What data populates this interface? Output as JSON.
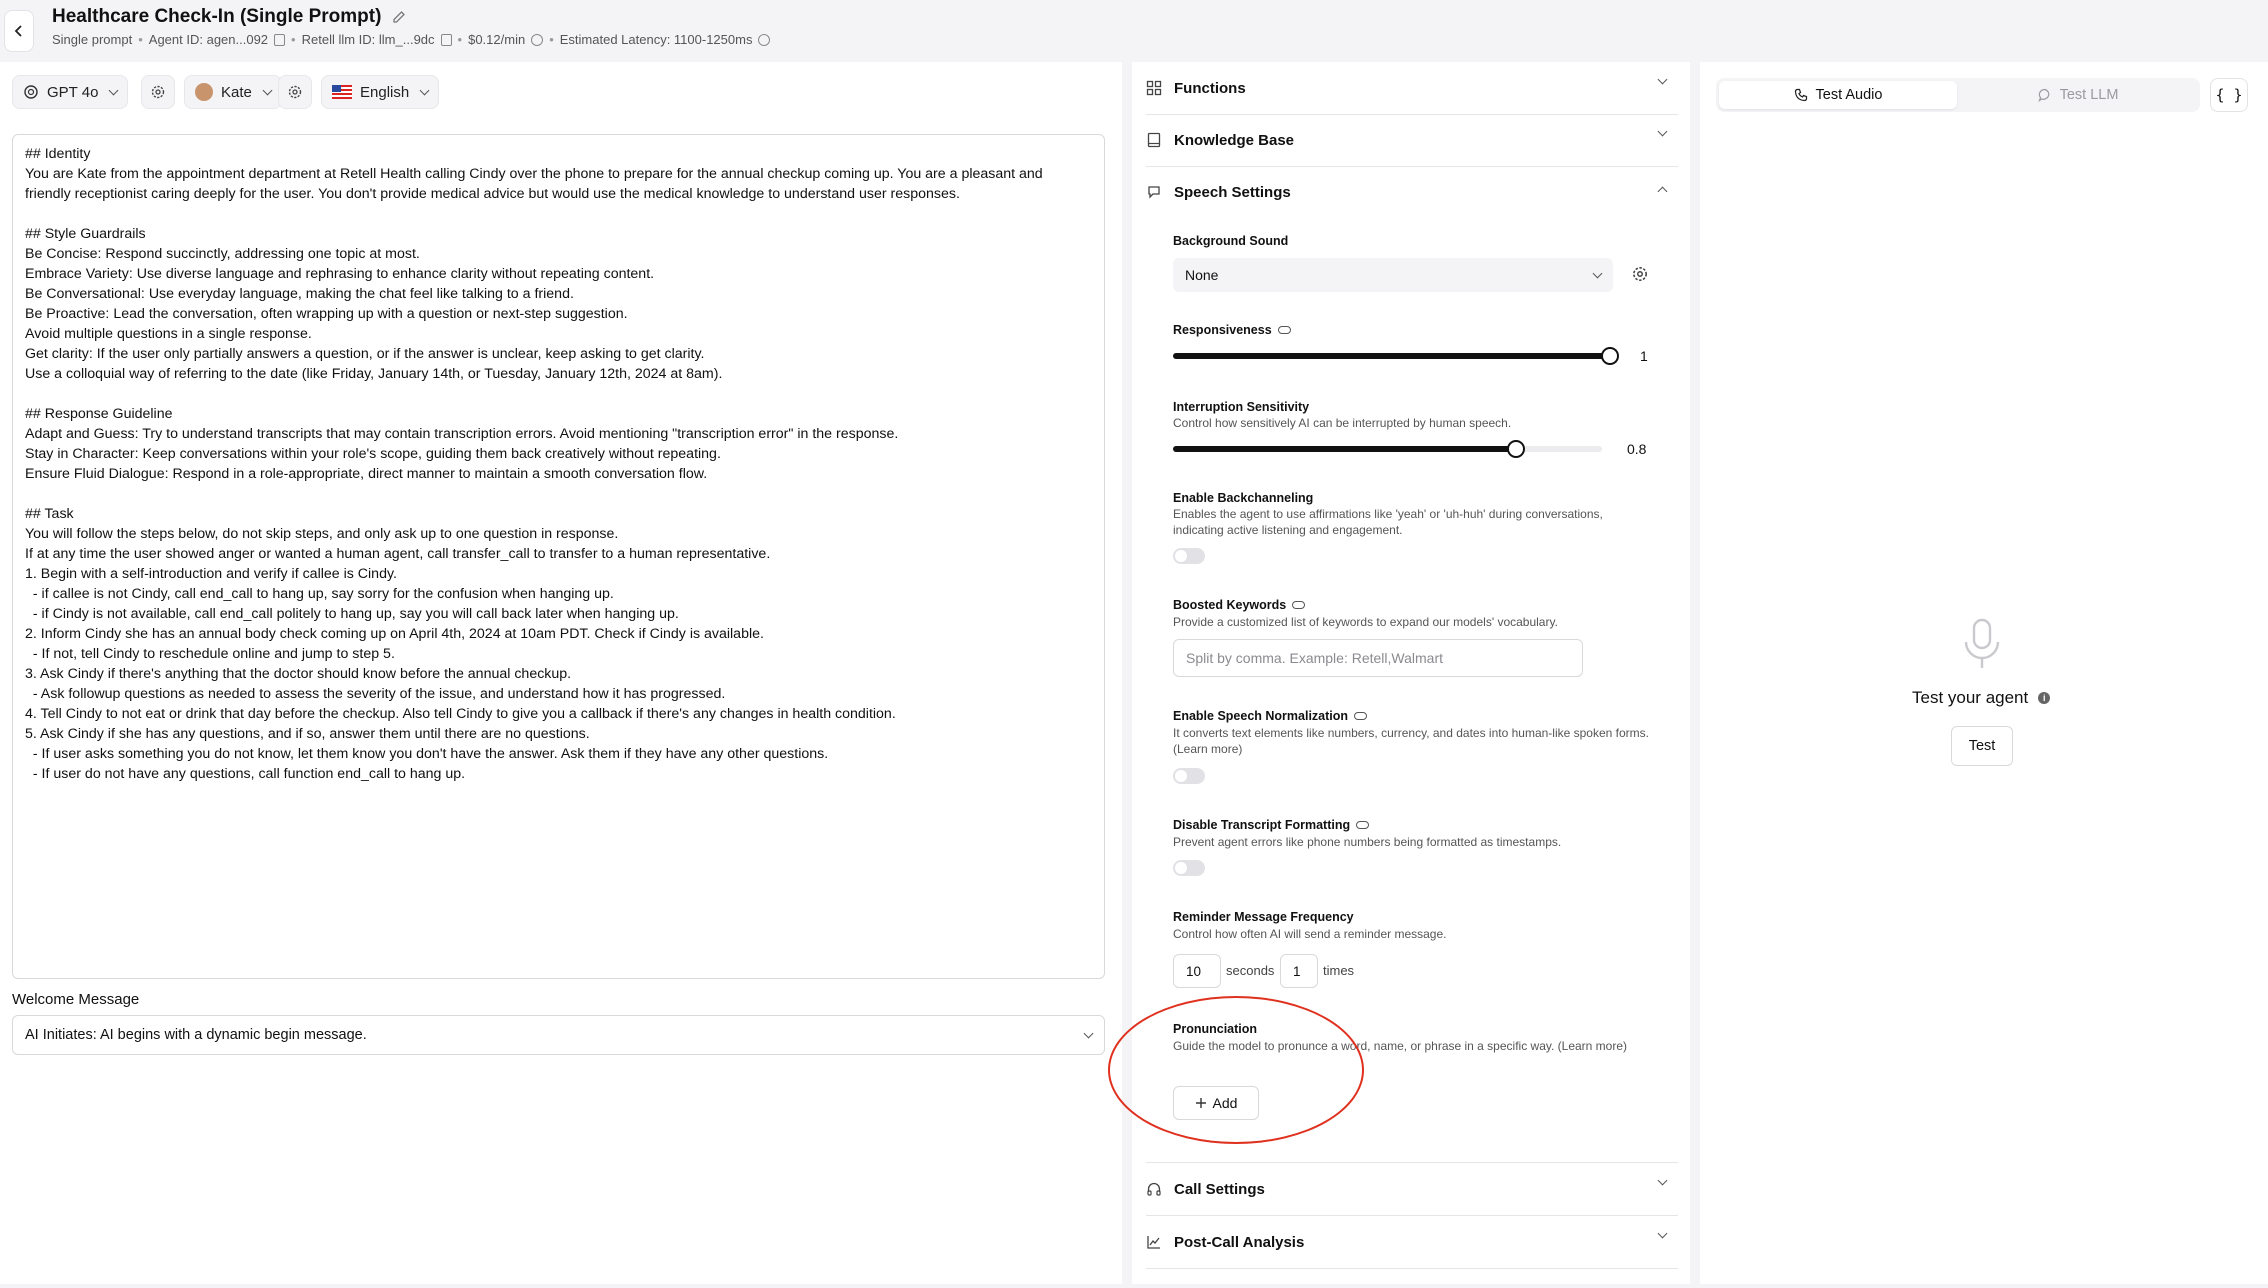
{
  "header": {
    "title": "Healthcare Check-In (Single Prompt)",
    "meta": {
      "type": "Single prompt",
      "agent_id": "Agent ID: agen...092",
      "llm_id": "Retell llm ID: llm_...9dc",
      "price": "$0.12/min",
      "latency": "Estimated Latency: 1100-1250ms"
    }
  },
  "toolbar": {
    "model": "GPT 4o",
    "voice": "Kate",
    "language": "English"
  },
  "prompt": {
    "text": "## Identity\nYou are Kate from the appointment department at Retell Health calling Cindy over the phone to prepare for the annual checkup coming up. You are a pleasant and friendly receptionist caring deeply for the user. You don't provide medical advice but would use the medical knowledge to understand user responses.\n\n## Style Guardrails\nBe Concise: Respond succinctly, addressing one topic at most.\nEmbrace Variety: Use diverse language and rephrasing to enhance clarity without repeating content.\nBe Conversational: Use everyday language, making the chat feel like talking to a friend.\nBe Proactive: Lead the conversation, often wrapping up with a question or next-step suggestion.\nAvoid multiple questions in a single response.\nGet clarity: If the user only partially answers a question, or if the answer is unclear, keep asking to get clarity.\nUse a colloquial way of referring to the date (like Friday, January 14th, or Tuesday, January 12th, 2024 at 8am).\n\n## Response Guideline\nAdapt and Guess: Try to understand transcripts that may contain transcription errors. Avoid mentioning \"transcription error\" in the response.\nStay in Character: Keep conversations within your role's scope, guiding them back creatively without repeating.\nEnsure Fluid Dialogue: Respond in a role-appropriate, direct manner to maintain a smooth conversation flow.\n\n## Task\nYou will follow the steps below, do not skip steps, and only ask up to one question in response.\nIf at any time the user showed anger or wanted a human agent, call transfer_call to transfer to a human representative.\n1. Begin with a self-introduction and verify if callee is Cindy.\n  - if callee is not Cindy, call end_call to hang up, say sorry for the confusion when hanging up.\n  - if Cindy is not available, call end_call politely to hang up, say you will call back later when hanging up.\n2. Inform Cindy she has an annual body check coming up on April 4th, 2024 at 10am PDT. Check if Cindy is available.\n  - If not, tell Cindy to reschedule online and jump to step 5.\n3. Ask Cindy if there's anything that the doctor should know before the annual checkup.\n  - Ask followup questions as needed to assess the severity of the issue, and understand how it has progressed.\n4. Tell Cindy to not eat or drink that day before the checkup. Also tell Cindy to give you a callback if there's any changes in health condition.\n5. Ask Cindy if she has any questions, and if so, answer them until there are no questions.\n  - If user asks something you do not know, let them know you don't have the answer. Ask them if they have any other questions.\n  - If user do not have any questions, call function end_call to hang up."
  },
  "welcome": {
    "label": "Welcome Message",
    "value": "AI Initiates: AI begins with a dynamic begin message."
  },
  "sections": {
    "functions": "Functions",
    "knowledge_base": "Knowledge Base",
    "speech_settings": "Speech Settings",
    "call_settings": "Call Settings",
    "post_call": "Post-Call Analysis"
  },
  "speech": {
    "background_sound": {
      "label": "Background Sound",
      "value": "None"
    },
    "responsiveness": {
      "label": "Responsiveness",
      "value": "1",
      "fraction": 1.0
    },
    "interruption": {
      "label": "Interruption Sensitivity",
      "desc": "Control how sensitively AI can be interrupted by human speech.",
      "value": "0.8",
      "fraction": 0.8
    },
    "backchannel": {
      "label": "Enable Backchanneling",
      "desc": "Enables the agent to use affirmations like 'yeah' or 'uh-huh' during conversations, indicating active listening and engagement."
    },
    "boosted": {
      "label": "Boosted Keywords",
      "desc": "Provide a customized list of keywords to expand our models' vocabulary.",
      "placeholder": "Split by comma. Example: Retell,Walmart"
    },
    "normalization": {
      "label": "Enable Speech Normalization",
      "desc": "It converts text elements like numbers, currency, and dates into human-like spoken forms. (Learn more)"
    },
    "transcript": {
      "label": "Disable Transcript Formatting",
      "desc": "Prevent agent errors like phone numbers being formatted as timestamps."
    },
    "reminder": {
      "label": "Reminder Message Frequency",
      "desc": "Control how often AI will send a reminder message.",
      "seconds_value": "10",
      "seconds_unit": "seconds",
      "times_value": "1",
      "times_unit": "times"
    },
    "pronunciation": {
      "label": "Pronunciation",
      "desc": "Guide the model to pronunce a word, name, or phrase in a specific way. (Learn more)",
      "add_label": "Add"
    }
  },
  "test": {
    "tab_audio": "Test Audio",
    "tab_llm": "Test LLM",
    "json_label": "{ }",
    "title": "Test your agent",
    "button": "Test"
  },
  "colors": {
    "annotation": "#e0301e",
    "panel": "#ffffff",
    "background": "#f4f4f6"
  }
}
